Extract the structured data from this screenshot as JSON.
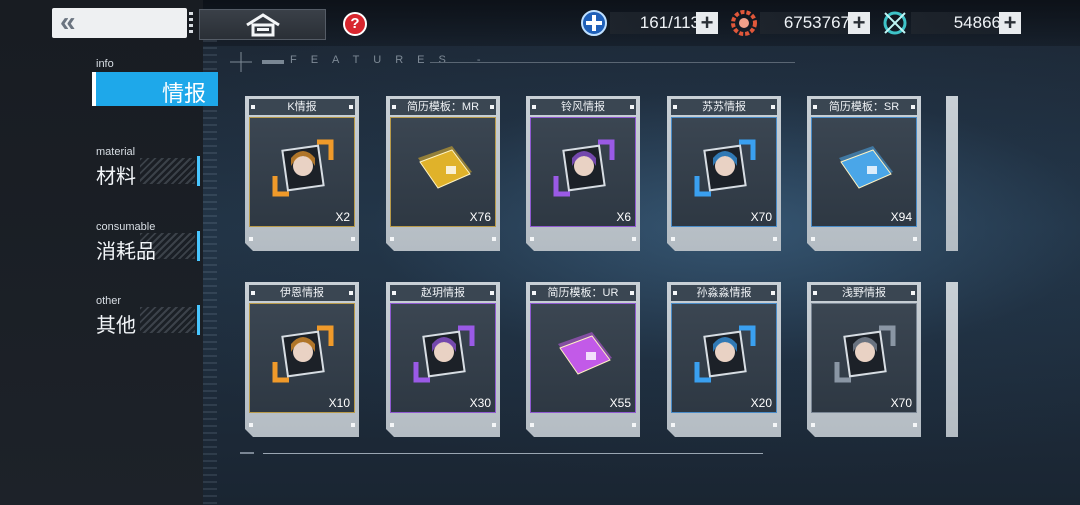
{
  "header": {
    "features_text": "FEATURES -",
    "help_label": "?"
  },
  "resources": [
    {
      "name": "stamina",
      "icon": "plus-circle-icon",
      "value": "161/113",
      "color": "#2c86e8"
    },
    {
      "name": "coins",
      "icon": "target-gear-icon",
      "value": "6753767",
      "color": "#e0573a"
    },
    {
      "name": "crystals",
      "icon": "spark-ring-icon",
      "value": "54866",
      "color": "#3ec3c8"
    }
  ],
  "sidebar": {
    "tabs": [
      {
        "en": "info",
        "zh": "情报",
        "active": true
      },
      {
        "en": "material",
        "zh": "材料",
        "active": false
      },
      {
        "en": "consumable",
        "zh": "消耗品",
        "active": false
      },
      {
        "en": "other",
        "zh": "其他",
        "active": false
      }
    ]
  },
  "items": [
    {
      "title": "K情报",
      "qty": "X2",
      "kind": "portrait",
      "rarity": "gold",
      "accent": "#f09a2a",
      "icon": "portrait-pink-hair-icon"
    },
    {
      "title": "简历模板：MR",
      "qty": "X76",
      "kind": "folder",
      "rarity": "gold",
      "accent": "#e0b22a",
      "icon": "gold-folder-icon"
    },
    {
      "title": "铃风情报",
      "qty": "X6",
      "kind": "portrait",
      "rarity": "purple",
      "accent": "#9a5ae6",
      "icon": "portrait-silver-hair-icon"
    },
    {
      "title": "苏苏情报",
      "qty": "X70",
      "kind": "portrait",
      "rarity": "blue",
      "accent": "#3aa0f0",
      "icon": "portrait-dark-hair-icon"
    },
    {
      "title": "简历模板：SR",
      "qty": "X94",
      "kind": "folder",
      "rarity": "blue",
      "accent": "#4aa6e8",
      "icon": "blue-folder-icon"
    },
    {
      "title": "伊恩情报",
      "qty": "X10",
      "kind": "portrait",
      "rarity": "gold",
      "accent": "#f09a2a",
      "icon": "portrait-black-hair-icon"
    },
    {
      "title": "赵玥情报",
      "qty": "X30",
      "kind": "portrait",
      "rarity": "purple",
      "accent": "#9a5ae6",
      "icon": "portrait-brown-hair-icon"
    },
    {
      "title": "简历模板：UR",
      "qty": "X55",
      "kind": "folder",
      "rarity": "purple",
      "accent": "#c25ae8",
      "icon": "purple-folder-icon"
    },
    {
      "title": "孙淼淼情报",
      "qty": "X20",
      "kind": "portrait",
      "rarity": "blue",
      "accent": "#3aa0f0",
      "icon": "portrait-blonde-hair-icon"
    },
    {
      "title": "浅野情报",
      "qty": "X70",
      "kind": "portrait",
      "rarity": "gray",
      "accent": "#8a96a4",
      "icon": "portrait-teal-hair-icon"
    }
  ]
}
